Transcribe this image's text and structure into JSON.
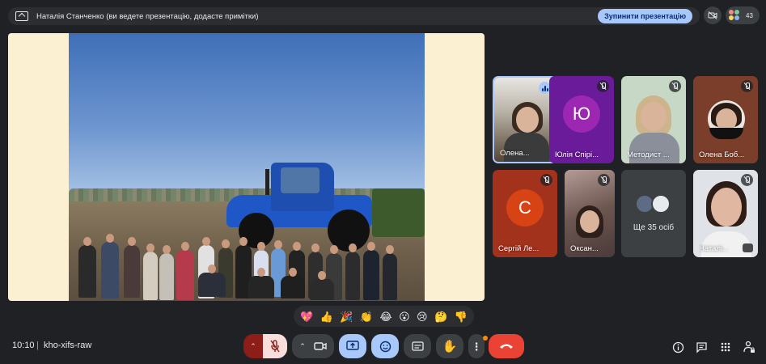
{
  "banner": {
    "text": "Наталія Станченко (ви ведете презентацію, додасте примітки)",
    "stop_button": "Зупинити презентацію",
    "participant_count": "43"
  },
  "participants": [
    {
      "name": "Олена...",
      "speaking": true
    },
    {
      "name": "Юлія Спірі...",
      "initial": "Ю",
      "avatar_color": "#9c27b0",
      "muted": true
    },
    {
      "name": "Методист ...",
      "muted": true
    },
    {
      "name": "Олена Боб...",
      "muted": true
    },
    {
      "name": "Сергій Ле...",
      "initial": "С",
      "avatar_color": "#d84315",
      "muted": true
    },
    {
      "name": "Оксан...",
      "muted": true
    },
    {
      "name": "Наталі...",
      "muted": true
    }
  ],
  "more_tile": {
    "label": "Ще 35 осіб"
  },
  "reactions": [
    "💖",
    "👍",
    "🎉",
    "👏",
    "😂",
    "😮",
    "😢",
    "🤔",
    "👎"
  ],
  "footer": {
    "time": "10:10",
    "separator": "|",
    "meeting_code": "kho-xifs-raw"
  },
  "colors": {
    "background": "#202124",
    "accent": "#a8c7fa",
    "end_call": "#ea4335"
  },
  "icons": {
    "present": "present-icon",
    "mic_off": "mic-off-icon",
    "camera": "camera-icon",
    "emoji": "emoji-icon",
    "captions": "captions-icon",
    "hand": "raise-hand-icon",
    "more": "more-vert-icon",
    "end_call": "end-call-icon",
    "info": "info-icon",
    "chat": "chat-icon",
    "activities": "activities-icon",
    "host_controls": "host-controls-icon"
  }
}
